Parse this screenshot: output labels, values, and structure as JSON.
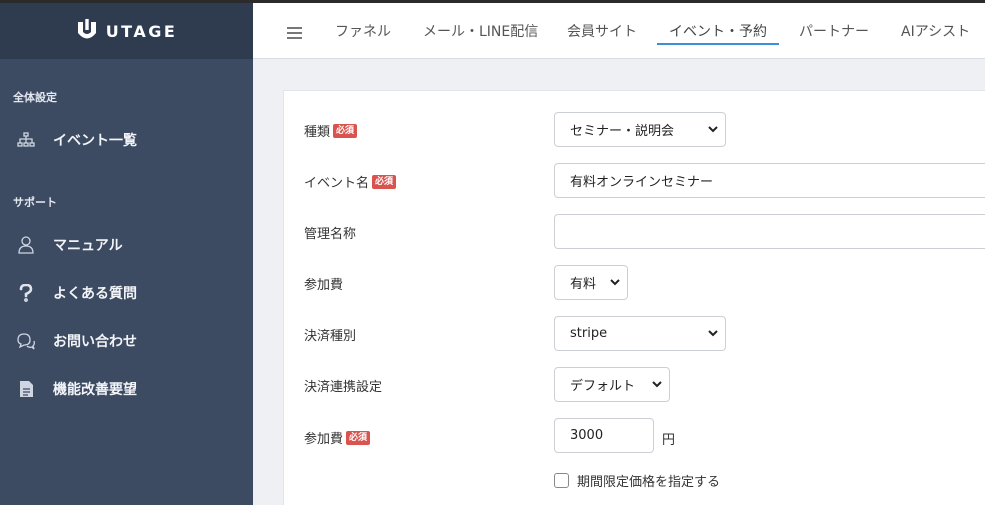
{
  "brand": {
    "name": "UTAGE"
  },
  "sidebar": {
    "section1": "全体設定",
    "section2": "サポート",
    "items": [
      {
        "label": "イベント一覧",
        "icon": "sitemap-icon"
      },
      {
        "label": "マニュアル",
        "icon": "user-icon"
      },
      {
        "label": "よくある質問",
        "icon": "question-icon"
      },
      {
        "label": "お問い合わせ",
        "icon": "chat-icon"
      },
      {
        "label": "機能改善要望",
        "icon": "document-icon"
      }
    ]
  },
  "nav": {
    "tabs": [
      "ファネル",
      "メール・LINE配信",
      "会員サイト",
      "イベント・予約",
      "パートナー",
      "AIアシスト"
    ],
    "active": "イベント・予約"
  },
  "form": {
    "required_badge": "必須",
    "type_label": "種類",
    "type_value": "セミナー・説明会",
    "event_name_label": "イベント名",
    "event_name_value": "有料オンラインセミナー",
    "admin_name_label": "管理名称",
    "admin_name_value": "",
    "fee_type_label": "参加費",
    "fee_type_value": "有料",
    "payment_type_label": "決済種別",
    "payment_type_value": "stripe",
    "payment_link_label": "決済連携設定",
    "payment_link_value": "デフォルト",
    "fee_label": "参加費",
    "fee_value": "3000",
    "fee_unit": "円",
    "limited_price_label": "期間限定価格を指定する"
  },
  "colors": {
    "sidebar": "#3c4a62",
    "logo_bar": "#2f3b4f",
    "accent": "#3b8fd6",
    "required": "#d9534f"
  }
}
